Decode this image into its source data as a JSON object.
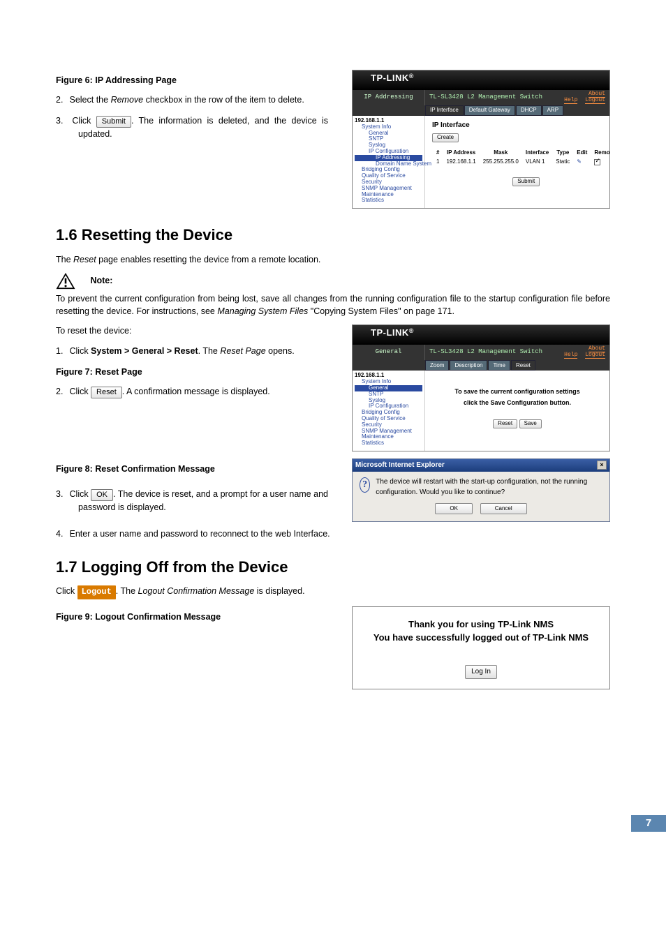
{
  "fig6": {
    "caption": "Figure 6: IP Addressing Page"
  },
  "step2": {
    "num": "2.",
    "prefix": "Select the ",
    "remove": "Remove",
    "suffix": " checkbox in the row of the item to delete."
  },
  "step3": {
    "num": "3.",
    "prefix": "Click ",
    "btn": "Submit",
    "suffix": ". The information is deleted, and the device is updated."
  },
  "shot6": {
    "logo": "TP-LINK",
    "sidehdr": "IP Addressing",
    "title": "TL-SL3428 L2 Management Switch",
    "links": {
      "about": "About",
      "help": "Help",
      "logout": "Logout"
    },
    "tabs": [
      "IP Interface",
      "Default Gateway",
      "DHCP",
      "ARP"
    ],
    "tree_ip": "192.168.1.1",
    "tree": [
      "System Info",
      "General",
      "SNTP",
      "Syslog",
      "IP Configuration",
      "IP Addressing",
      "Domain Name System",
      "Bridging Config",
      "Quality of Service",
      "Security",
      "SNMP Management",
      "Maintenance",
      "Statistics"
    ],
    "panel_h": "IP Interface",
    "create": "Create",
    "cols": [
      "#",
      "IP Address",
      "Mask",
      "Interface",
      "Type",
      "Edit",
      "Remove"
    ],
    "row": {
      "idx": "1",
      "ip": "192.168.1.1",
      "mask": "255.255.255.0",
      "iface": "VLAN 1",
      "type": "Static"
    },
    "submit": "Submit"
  },
  "sec16": {
    "heading": "1.6  Resetting the Device",
    "intro_a": "The ",
    "intro_b": "Reset",
    "intro_c": " page enables resetting the device from a remote location.",
    "note_label": "Note:",
    "note_a": "To prevent the current configuration from being lost, save all changes from the running configuration file to the startup configuration file before resetting the device. For instructions, see ",
    "note_i": "Managing System Files",
    "note_b": " \"Copying System Files\" on page 171.",
    "toreset": "To reset the device:",
    "s1": {
      "num": "1.",
      "a": "Click ",
      "path": "System > General > Reset",
      "b": ". The ",
      "page": "Reset Page",
      "c": " opens."
    },
    "fig7": "Figure 7: Reset Page",
    "s2": {
      "num": "2.",
      "a": "Click ",
      "btn": "Reset",
      "b": ". A confirmation message is displayed."
    },
    "fig8": "Figure 8: Reset Confirmation Message",
    "s3": {
      "num": "3.",
      "a": "Click ",
      "btn": "OK",
      "b": ". The device is reset, and a prompt for a user name and password is displayed."
    },
    "s4": {
      "num": "4.",
      "t": "Enter a user name and password to reconnect to the web Interface."
    }
  },
  "shot7": {
    "logo": "TP-LINK",
    "sidehdr": "General",
    "title": "TL-SL3428 L2 Management Switch",
    "links": {
      "about": "About",
      "help": "Help",
      "logout": "Logout"
    },
    "tabs": [
      "Zoom",
      "Description",
      "Time",
      "Reset"
    ],
    "tree_ip": "192.168.1.1",
    "tree": [
      "System Info",
      "General",
      "SNTP",
      "Syslog",
      "IP Configuration",
      "Bridging Config",
      "Quality of Service",
      "Security",
      "SNMP Management",
      "Maintenance",
      "Statistics"
    ],
    "msg1": "To save the current configuration settings",
    "msg2": "click the Save Configuration button.",
    "reset": "Reset",
    "save": "Save"
  },
  "dlg8": {
    "title": "Microsoft Internet Explorer",
    "msg": "The device will restart with the start-up configuration, not the running configuration. Would you like to continue?",
    "ok": "OK",
    "cancel": "Cancel"
  },
  "sec17": {
    "heading": "1.7  Logging Off from the Device",
    "a": "Click ",
    "btn": "Logout",
    "b": ". The ",
    "i": "Logout Confirmation Message",
    "c": " is displayed.",
    "fig9": "Figure 9: Logout Confirmation Message"
  },
  "logout": {
    "l1": "Thank you for using TP-Link NMS",
    "l2": "You have successfully logged out of TP-Link NMS",
    "btn": "Log In"
  },
  "page_number": "7"
}
